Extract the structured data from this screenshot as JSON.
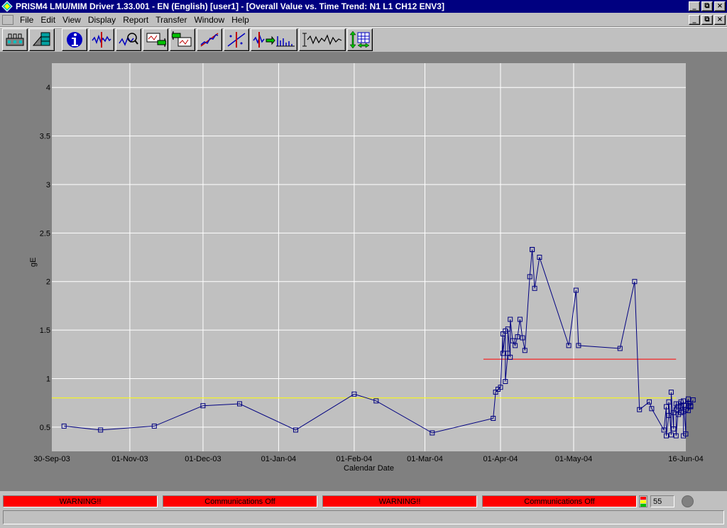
{
  "window": {
    "title": "PRISM4 LMU/MIM Driver 1.33.001 - EN (English) [user1] - [Overall Value vs. Time Trend: N1  L1 CH12 ENV3]",
    "controls": {
      "minimize": "_",
      "restore": "⧉",
      "close": "×"
    }
  },
  "menu": {
    "items": [
      "File",
      "Edit",
      "View",
      "Display",
      "Report",
      "Transfer",
      "Window",
      "Help"
    ]
  },
  "toolbar": {
    "buttons": [
      {
        "name": "database-icon"
      },
      {
        "name": "machine-setup-icon"
      },
      {
        "name": "info-icon"
      },
      {
        "name": "waveform-cursor-icon"
      },
      {
        "name": "waveform-zoom-icon"
      },
      {
        "name": "transfer-right-icon"
      },
      {
        "name": "transfer-left-icon"
      },
      {
        "name": "trend-fit-icon"
      },
      {
        "name": "trend-cursor-icon"
      },
      {
        "name": "spectrum-icon"
      },
      {
        "name": "time-waveform-icon"
      },
      {
        "name": "table-view-icon"
      }
    ]
  },
  "chart_data": {
    "type": "line",
    "xlabel": "Calendar Date",
    "ylabel": "gE",
    "x_ticks": [
      "30-Sep-03",
      "01-Nov-03",
      "01-Dec-03",
      "01-Jan-04",
      "01-Feb-04",
      "01-Mar-04",
      "01-Apr-04",
      "01-May-04",
      "16-Jun-04"
    ],
    "y_ticks": [
      "0.5",
      "1",
      "1.5",
      "2",
      "2.5",
      "3",
      "3.5",
      "4"
    ],
    "ylim": [
      0.25,
      4.25
    ],
    "xlim": [
      "2003-09-30",
      "2004-06-16"
    ],
    "grid": true,
    "colors": {
      "series": "#000080",
      "alarm": "#ff0000",
      "alert": "#ffff00",
      "plot_bg": "#c0c0c0",
      "grid": "#ffffff"
    },
    "reference_lines": [
      {
        "value": 1.2,
        "color": "#ff0000",
        "from": "2004-03-25",
        "to": "2004-06-12"
      },
      {
        "value": 0.8,
        "color": "#ffff00",
        "from": "2003-09-30",
        "to": "2004-06-12"
      }
    ],
    "series": [
      {
        "x": [
          "2003-10-05",
          "2003-10-20",
          "2003-11-11",
          "2003-12-01",
          "2003-12-16",
          "2004-01-08",
          "2004-02-01",
          "2004-02-10",
          "2004-03-04",
          "2004-03-29",
          "2004-03-30",
          "2004-03-31",
          "2004-04-01",
          "2004-04-02",
          "2004-04-02",
          "2004-04-03",
          "2004-04-03",
          "2004-04-04",
          "2004-04-04",
          "2004-04-05",
          "2004-04-05",
          "2004-04-06",
          "2004-04-07",
          "2004-04-08",
          "2004-04-09",
          "2004-04-10",
          "2004-04-11",
          "2004-04-13",
          "2004-04-14",
          "2004-04-14",
          "2004-04-15",
          "2004-04-17",
          "2004-04-29",
          "2004-05-02",
          "2004-05-03",
          "2004-05-20",
          "2004-05-26",
          "2004-05-28",
          "2004-06-01",
          "2004-06-02",
          "2004-06-07",
          "2004-06-08",
          "2004-06-08",
          "2004-06-09",
          "2004-06-09",
          "2004-06-10",
          "2004-06-10",
          "2004-06-11",
          "2004-06-11",
          "2004-06-12",
          "2004-06-12",
          "2004-06-12",
          "2004-06-13",
          "2004-06-13",
          "2004-06-13",
          "2004-06-14",
          "2004-06-14",
          "2004-06-14",
          "2004-06-15",
          "2004-06-15",
          "2004-06-15",
          "2004-06-16",
          "2004-06-16",
          "2004-06-16",
          "2004-06-17",
          "2004-06-17",
          "2004-06-17",
          "2004-06-18",
          "2004-06-18",
          "2004-06-18",
          "2004-06-19"
        ],
        "values": [
          0.51,
          0.47,
          0.51,
          0.72,
          0.74,
          0.47,
          0.84,
          0.77,
          0.44,
          0.59,
          0.86,
          0.89,
          0.91,
          1.46,
          1.26,
          1.49,
          0.97,
          1.26,
          1.51,
          1.22,
          1.61,
          1.39,
          1.34,
          1.43,
          1.61,
          1.42,
          1.29,
          2.05,
          2.33,
          2.33,
          1.93,
          2.25,
          1.34,
          1.91,
          1.34,
          1.31,
          2.0,
          0.68,
          0.76,
          0.69,
          0.47,
          0.71,
          0.41,
          0.62,
          0.76,
          0.42,
          0.86,
          0.48,
          0.65,
          0.74,
          0.68,
          0.41,
          0.71,
          0.74,
          0.63,
          0.72,
          0.65,
          0.76,
          0.66,
          0.41,
          0.77,
          0.43,
          0.72,
          0.68,
          0.79,
          0.74,
          0.67,
          0.71,
          0.72,
          0.72,
          0.78
        ]
      }
    ]
  },
  "status": {
    "boxes": [
      "WARNING!!",
      "Communications Off",
      "WARNING!!",
      "Communications Off"
    ],
    "counter": "55"
  }
}
